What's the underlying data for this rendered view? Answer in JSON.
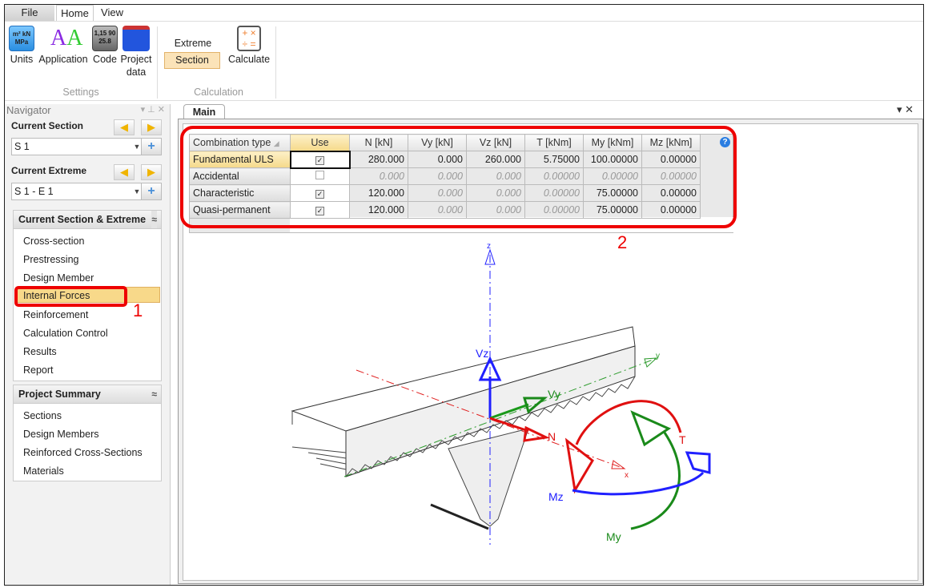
{
  "ribbon": {
    "tabs": [
      "File",
      "Home",
      "View"
    ],
    "buttons": {
      "units": "Units",
      "application": "Application",
      "code": "Code",
      "project_data_1": "Project",
      "project_data_2": "data",
      "extreme": "Extreme",
      "section": "Section",
      "calculate": "Calculate"
    },
    "groups": {
      "settings": "Settings",
      "calculation": "Calculation"
    },
    "icon_text": {
      "units": "m² kN MPa",
      "code": "1,15 90 25.8"
    }
  },
  "navigator": {
    "title": "Navigator",
    "current_section_label": "Current Section",
    "current_section_value": "S 1",
    "current_extreme_label": "Current Extreme",
    "current_extreme_value": "S 1 - E 1",
    "panel1_title": "Current Section & Extreme",
    "panel1_items": [
      "Cross-section",
      "Prestressing",
      "Design Member",
      "Internal Forces",
      "Reinforcement",
      "Calculation Control",
      "Results",
      "Report"
    ],
    "panel2_title": "Project Summary",
    "panel2_items": [
      "Sections",
      "Design Members",
      "Reinforced Cross-Sections",
      "Materials"
    ]
  },
  "main": {
    "tab": "Main",
    "table": {
      "headers": [
        "Combination type",
        "Use",
        "N [kN]",
        "Vy [kN]",
        "Vz [kN]",
        "T [kNm]",
        "My [kNm]",
        "Mz [kNm]"
      ],
      "rows": [
        {
          "name": "Fundamental ULS",
          "use": true,
          "values": [
            "280.000",
            "0.000",
            "260.000",
            "5.75000",
            "100.00000",
            "0.00000"
          ]
        },
        {
          "name": "Accidental",
          "use": false,
          "values": [
            "0.000",
            "0.000",
            "0.000",
            "0.00000",
            "0.00000",
            "0.00000"
          ]
        },
        {
          "name": "Characteristic",
          "use": true,
          "values": [
            "120.000",
            "0.000",
            "0.000",
            "0.00000",
            "75.00000",
            "0.00000"
          ]
        },
        {
          "name": "Quasi-permanent",
          "use": true,
          "values": [
            "120.000",
            "0.000",
            "0.000",
            "0.00000",
            "75.00000",
            "0.00000"
          ]
        }
      ]
    },
    "diagram": {
      "z": "z",
      "y": "y",
      "x": "x",
      "Vz": "Vz",
      "Vy": "Vy",
      "N": "N",
      "T": "T",
      "Mz": "Mz",
      "My": "My"
    }
  },
  "annotations": {
    "one": "1",
    "two": "2"
  },
  "colors": {
    "highlight": "#e00000",
    "selected": "#f8d98a"
  }
}
